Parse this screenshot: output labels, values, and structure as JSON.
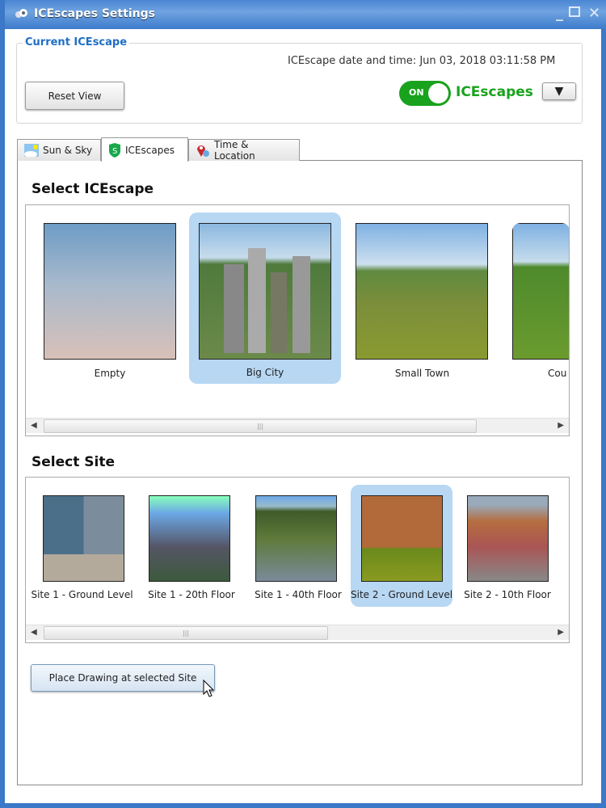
{
  "window": {
    "title": "ICEscapes Settings"
  },
  "current": {
    "group_label": "Current ICEscape",
    "datetime": "ICEscape date and time: Jun 03, 2018  03:11:58 PM",
    "reset_label": "Reset View",
    "toggle_state": "ON",
    "toggle_label": "ICEscapes",
    "toggle_on": true
  },
  "tabs": [
    {
      "label": "Sun & Sky",
      "icon": "sun-sky-icon"
    },
    {
      "label": "ICEscapes",
      "icon": "icescapes-shield-icon",
      "active": true
    },
    {
      "label": "Time & Location",
      "icon": "location-pin-icon"
    }
  ],
  "select_icescape": {
    "heading": "Select ICEscape",
    "items": [
      {
        "label": "Empty"
      },
      {
        "label": "Big City",
        "selected": true
      },
      {
        "label": "Small Town"
      },
      {
        "label": "Cou"
      }
    ]
  },
  "select_site": {
    "heading": "Select Site",
    "items": [
      {
        "label": "Site 1 - Ground Level"
      },
      {
        "label": "Site 1 - 20th Floor"
      },
      {
        "label": "Site 1 - 40th Floor"
      },
      {
        "label": "Site 2 - Ground Level",
        "selected": true
      },
      {
        "label": "Site 2 - 10th Floor"
      }
    ]
  },
  "place_button": "Place Drawing at selected Site",
  "colors": {
    "accent": "#1e6fc4",
    "toggle_green": "#19a21d",
    "selection": "#b7d7f3"
  }
}
